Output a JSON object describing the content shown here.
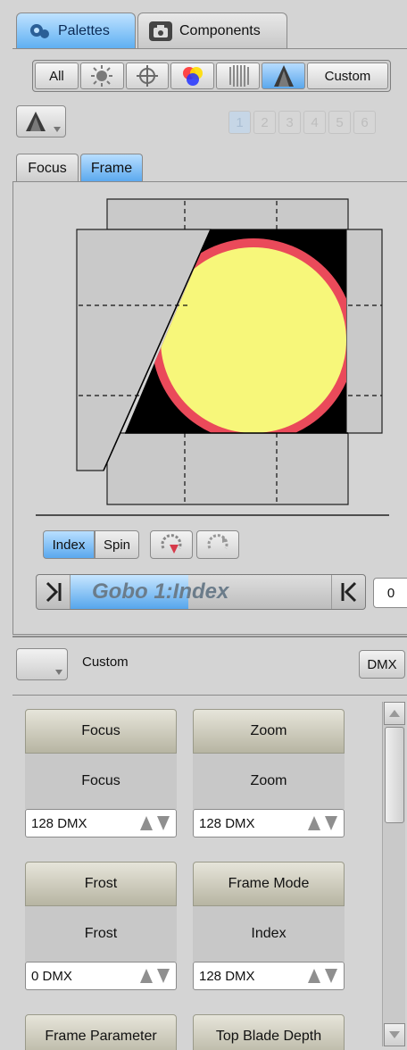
{
  "tabs": {
    "palettes": "Palettes",
    "components": "Components"
  },
  "filters": {
    "all": "All",
    "custom": "Custom",
    "icons": [
      "intensity-icon",
      "position-icon",
      "color-icon",
      "beam-icon",
      "beamshape-icon"
    ]
  },
  "pages": [
    "1",
    "2",
    "3",
    "4",
    "5",
    "6"
  ],
  "subtabs": {
    "focus": "Focus",
    "frame": "Frame"
  },
  "frame_mode": {
    "index": "Index",
    "spin": "Spin"
  },
  "fader": {
    "label": "Gobo 1:Index",
    "value": "0",
    "fill_fraction": 0.45
  },
  "custom_section": {
    "label": "Custom",
    "dmx_button": "DMX"
  },
  "params": [
    {
      "header": "Focus",
      "value": "Focus",
      "dmx": "128 DMX"
    },
    {
      "header": "Zoom",
      "value": "Zoom",
      "dmx": "128 DMX"
    },
    {
      "header": "Frost",
      "value": "Frost",
      "dmx": "0 DMX"
    },
    {
      "header": "Frame Mode",
      "value": "Index",
      "dmx": "128 DMX"
    },
    {
      "header": "Frame Parameter",
      "value": "",
      "dmx": ""
    },
    {
      "header": "Top Blade Depth",
      "value": "",
      "dmx": ""
    }
  ],
  "colors": {
    "accent": "#5aa8ee",
    "beam_fill": "#f7f77a",
    "beam_ring": "#ea4a5a",
    "header_olive": "#b7b5a2"
  }
}
